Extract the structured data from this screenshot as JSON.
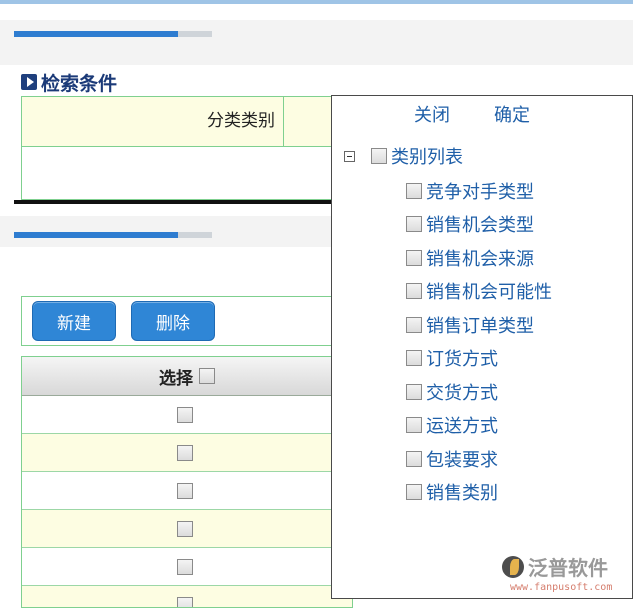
{
  "search_section": {
    "title": "检索条件",
    "category_label": "分类类别"
  },
  "progress": [
    {
      "fill_percent": 83
    },
    {
      "fill_percent": 83
    }
  ],
  "toolbar": {
    "new_label": "新建",
    "delete_label": "删除"
  },
  "grid": {
    "select_header": "选择",
    "rows": [
      {
        "checked": false
      },
      {
        "checked": false
      },
      {
        "checked": false
      },
      {
        "checked": false
      },
      {
        "checked": false
      },
      {
        "checked": false
      }
    ]
  },
  "popup": {
    "close_label": "关闭",
    "confirm_label": "确定",
    "tree_root_label": "类别列表",
    "items": [
      {
        "label": "竞争对手类型"
      },
      {
        "label": "销售机会类型"
      },
      {
        "label": "销售机会来源"
      },
      {
        "label": "销售机会可能性"
      },
      {
        "label": "销售订单类型"
      },
      {
        "label": "订货方式"
      },
      {
        "label": "交货方式"
      },
      {
        "label": "运送方式"
      },
      {
        "label": "包装要求"
      },
      {
        "label": "销售类别"
      }
    ]
  },
  "logo": {
    "text": "泛普软件",
    "url": "www.fanpusoft.com"
  },
  "colors": {
    "accent_blue": "#2e7cd0",
    "title_navy": "#1b3a78",
    "border_green": "#7fd08f",
    "row_highlight": "#fdfde2",
    "link_blue": "#1f5fa8"
  }
}
